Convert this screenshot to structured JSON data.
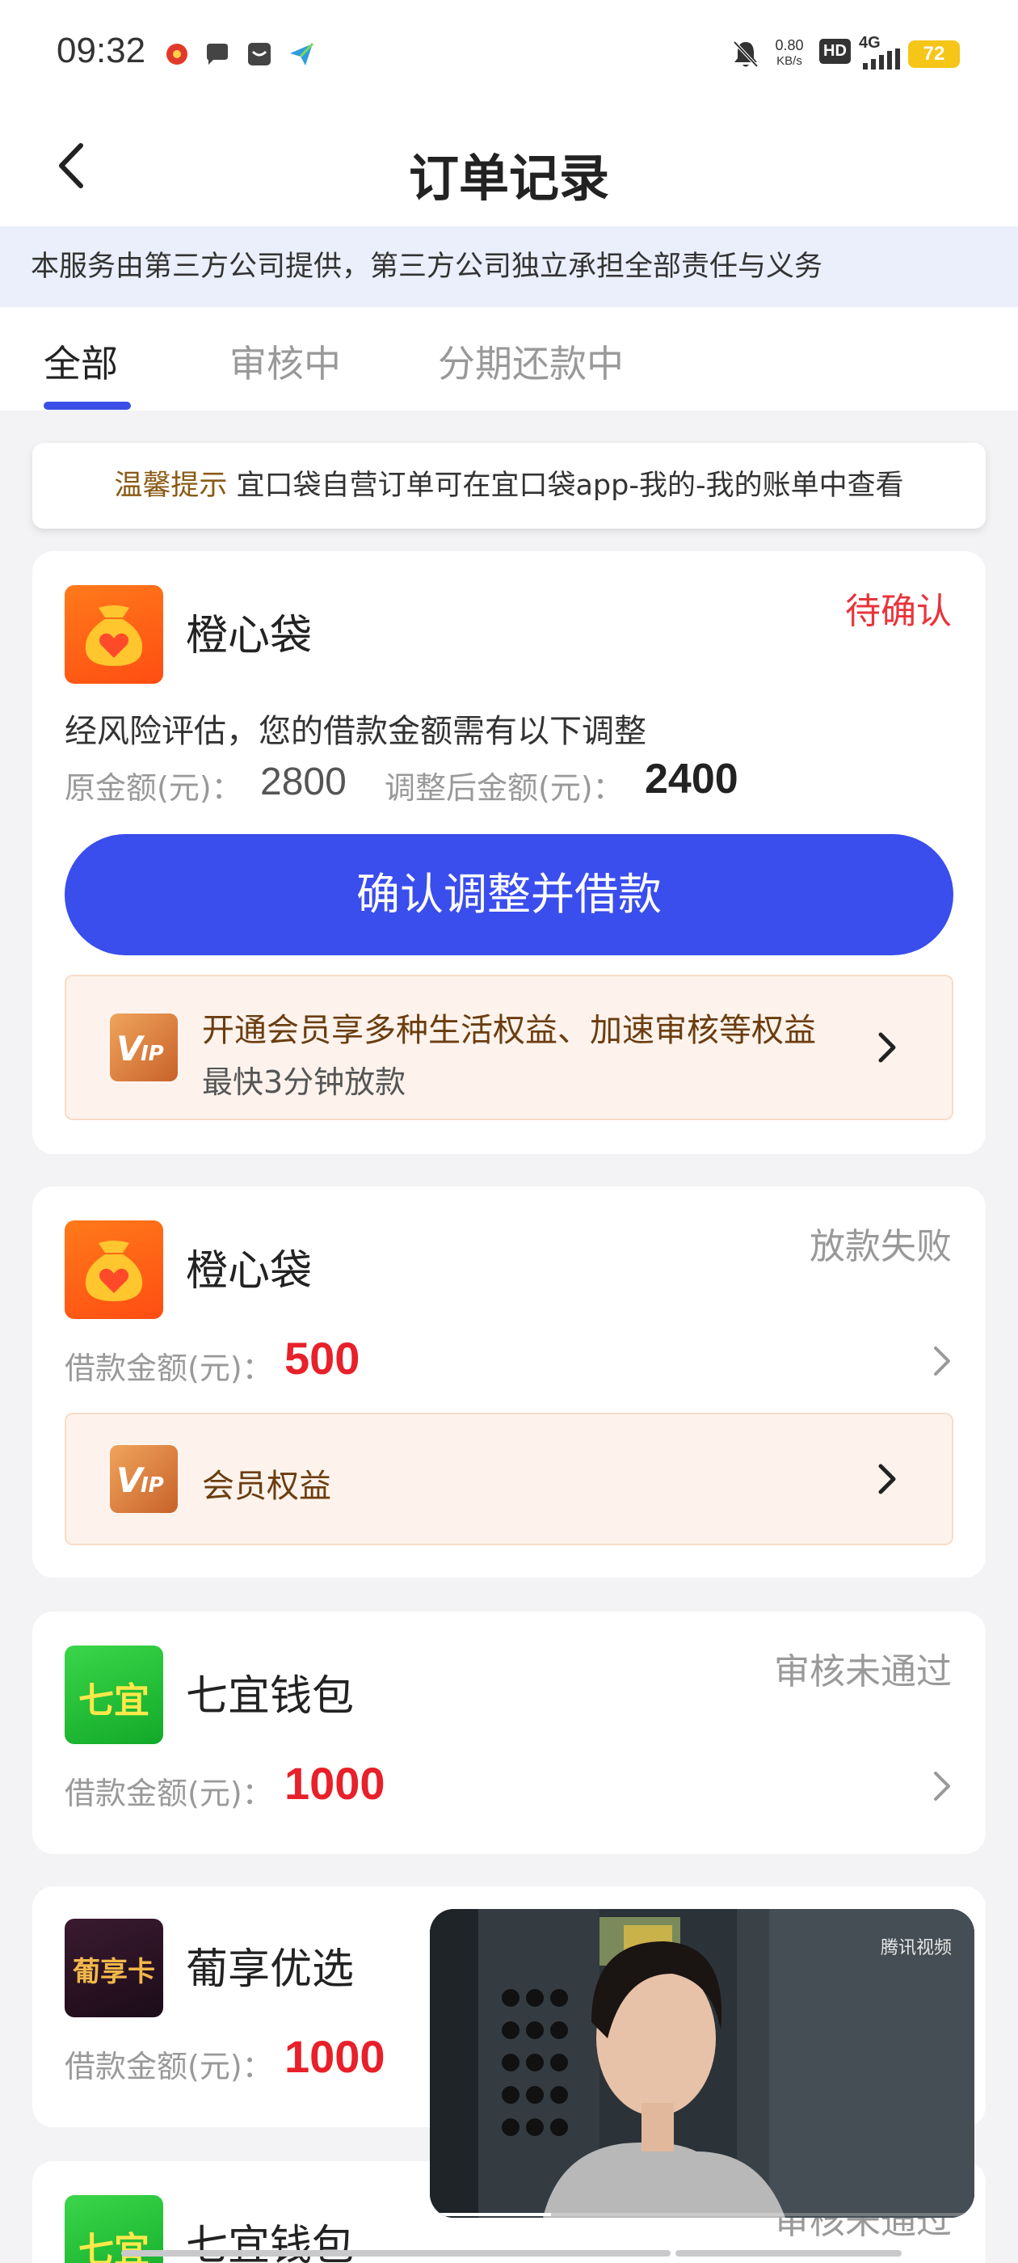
{
  "status_bar": {
    "time": "09:32",
    "net_speed_value": "0.80",
    "net_speed_unit": "KB/s",
    "hd": "HD",
    "network": "4G",
    "battery": "72"
  },
  "header": {
    "title": "订单记录"
  },
  "notice": "本服务由第三方公司提供，第三方公司独立承担全部责任与义务",
  "tabs": [
    {
      "label": "全部"
    },
    {
      "label": "审核中"
    },
    {
      "label": "分期还款中"
    }
  ],
  "tip": {
    "label": "温馨提示",
    "text": " 宜口袋自营订单可在宜口袋app-我的-我的账单中查看"
  },
  "orders": [
    {
      "brand": "橙心袋",
      "status": "待确认",
      "adjust_desc": "经风险评估，您的借款金额需有以下调整",
      "orig_label": "原金额(元)：",
      "orig_amount": "2800",
      "adjusted_label": "调整后金额(元)：",
      "adjusted_amount": "2400",
      "button": "确认调整并借款",
      "vip_title": "开通会员享多种生活权益、加速审核等权益",
      "vip_sub": "最快3分钟放款"
    },
    {
      "brand": "橙心袋",
      "status": "放款失败",
      "amount_label": "借款金额(元)：",
      "amount": "500",
      "vip_title": "会员权益"
    },
    {
      "brand": "七宜钱包",
      "logo_text": "七宜",
      "status": "审核未通过",
      "amount_label": "借款金额(元)：",
      "amount": "1000"
    },
    {
      "brand": "葡享优选",
      "logo_text": "葡享卡",
      "amount_label": "借款金额(元)：",
      "amount": "1000"
    },
    {
      "brand": "七宜钱包",
      "logo_text": "七宜",
      "status": "审核未通过"
    }
  ],
  "video": {
    "watermark": "腾讯视频"
  },
  "colors": {
    "primary": "#3a4ded",
    "status_red": "#e8343b",
    "amount_red": "#e8202a",
    "notice_bg": "#ebeefb",
    "vip_bg": "#fdf3ec"
  }
}
